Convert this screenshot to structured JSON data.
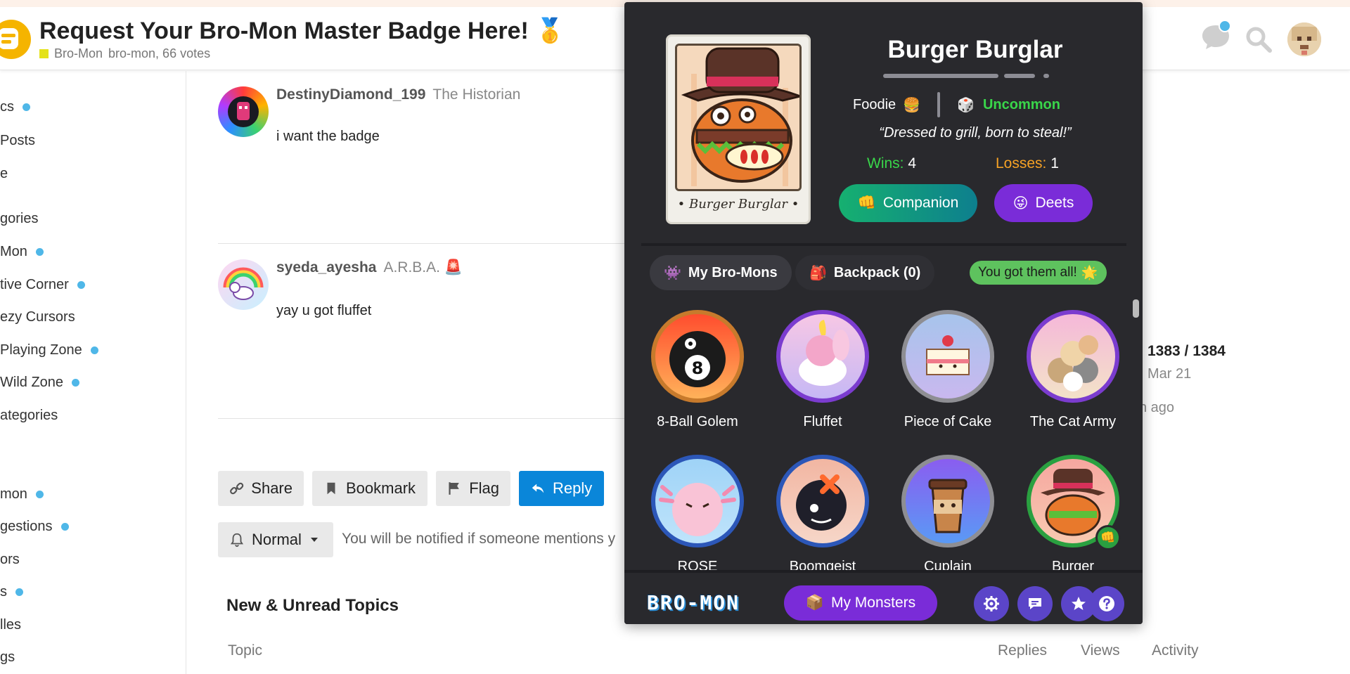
{
  "header": {
    "title": "Request Your Bro-Mon Master Badge Here!",
    "title_emoji": "🥇",
    "category": "Bro-Mon",
    "meta": "bro-mon, 66 votes"
  },
  "sidebar": {
    "items": [
      {
        "label": "cs",
        "dot": true
      },
      {
        "label": "Posts",
        "dot": false
      },
      {
        "label": "e",
        "dot": false
      },
      {
        "label": "gories",
        "dot": false
      },
      {
        "label": "Mon",
        "dot": true
      },
      {
        "label": "tive Corner",
        "dot": true
      },
      {
        "label": "ezy Cursors",
        "dot": false
      },
      {
        "label": "Playing Zone",
        "dot": true
      },
      {
        "label": "Wild Zone",
        "dot": true
      },
      {
        "label": "ategories",
        "dot": false
      },
      {
        "label": "mon",
        "dot": true
      },
      {
        "label": "gestions",
        "dot": true
      },
      {
        "label": "ors",
        "dot": false
      },
      {
        "label": "s",
        "dot": true
      },
      {
        "label": "lles",
        "dot": false
      },
      {
        "label": "gs",
        "dot": false
      }
    ]
  },
  "posts": [
    {
      "username": "DestinyDiamond_199",
      "title": "The Historian",
      "body": "i want the badge"
    },
    {
      "username": "syeda_ayesha",
      "title": "A.R.B.A.",
      "title_emoji": "🚨",
      "body": "yay u got fluffet"
    }
  ],
  "actions": {
    "share": "Share",
    "bookmark": "Bookmark",
    "flag": "Flag",
    "reply": "Reply"
  },
  "notifications": {
    "level": "Normal",
    "text": "You will be notified if someone mentions y"
  },
  "new_unread": {
    "title": "New & Unread Topics",
    "columns": [
      "Topic",
      "Replies",
      "Views",
      "Activity"
    ]
  },
  "timeline": {
    "position": "1383 / 1384",
    "date": "Mar 21",
    "ago": "h ago"
  },
  "popup": {
    "card_name": "• Burger Burglar •",
    "monster_name": "Burger Burglar",
    "type": "Foodie",
    "type_emoji": "🍔",
    "rarity_emoji": "🎲",
    "rarity": "Uncommon",
    "quote": "“Dressed to grill, born to steal!”",
    "wins_label": "Wins:",
    "wins": "4",
    "losses_label": "Losses:",
    "losses": "1",
    "companion_btn": "Companion",
    "companion_emoji": "👊",
    "deets_btn": "Deets",
    "deets_emoji": "😜",
    "tabs": {
      "my_bromons": "My Bro-Mons",
      "my_bromons_emoji": "👾",
      "backpack": "Backpack (0)",
      "backpack_emoji": "🎒",
      "got_all": "You got them all!",
      "got_all_emoji": "🌟"
    },
    "monsters": [
      {
        "name": "8-Ball Golem",
        "ring": "#c77a2c",
        "bg": "#ff6a3d"
      },
      {
        "name": "Fluffet",
        "ring": "#7b3ccf",
        "bg": "#f7c7e5"
      },
      {
        "name": "Piece of Cake",
        "ring": "#8e8e93",
        "bg": "#a7c4ec"
      },
      {
        "name": "The Cat Army",
        "ring": "#7b3ccf",
        "bg": "#f5b8d9"
      },
      {
        "name": "ROSE",
        "ring": "#2c57b8",
        "bg": "#9fd3f7"
      },
      {
        "name": "Boomgeist",
        "ring": "#2c57b8",
        "bg": "#f2b6a2"
      },
      {
        "name": "Cuplain",
        "ring": "#8e8e93",
        "bg": "#7a7cf0"
      },
      {
        "name": "Burger",
        "ring": "#2aa040",
        "bg": "#f6a7a0"
      }
    ],
    "footer": {
      "logo": "BRO-MON",
      "my_monsters": "My Monsters",
      "my_monsters_emoji": "📦"
    }
  }
}
